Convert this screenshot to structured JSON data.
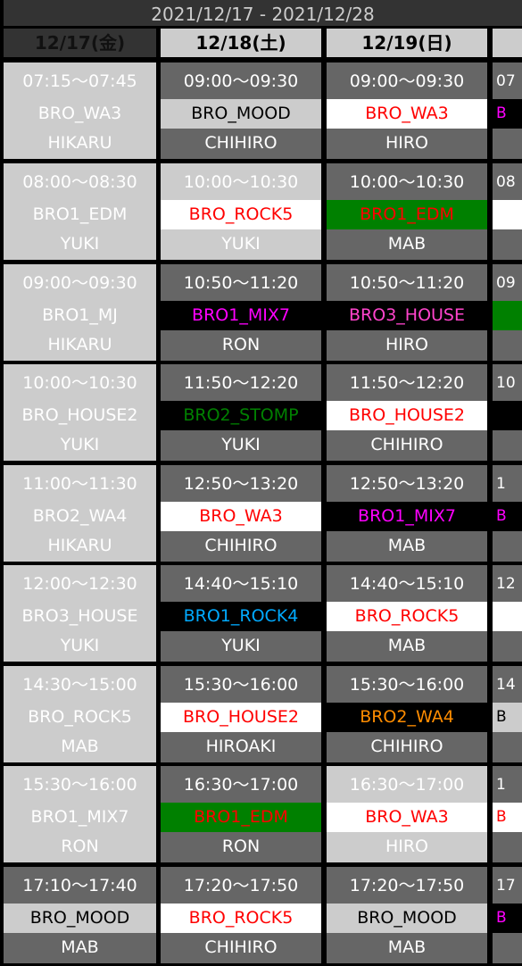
{
  "title": "2021/12/17 - 2021/12/28",
  "columns": [
    {
      "date": "12/17(金)",
      "selected": true,
      "cells": [
        {
          "time": "07:15〜07:45",
          "name": "BRO_WA3",
          "person": "HIKARU",
          "style": "all-light"
        },
        {
          "time": "08:00〜08:30",
          "name": "BRO1_EDM",
          "person": "YUKI",
          "style": "all-light"
        },
        {
          "time": "09:00〜09:30",
          "name": "BRO1_MJ",
          "person": "HIKARU",
          "style": "all-light"
        },
        {
          "time": "10:00〜10:30",
          "name": "BRO_HOUSE2",
          "person": "YUKI",
          "style": "all-light"
        },
        {
          "time": "11:00〜11:30",
          "name": "BRO2_WA4",
          "person": "HIKARU",
          "style": "all-light"
        },
        {
          "time": "12:00〜12:30",
          "name": "BRO3_HOUSE",
          "person": "YUKI",
          "style": "all-light"
        },
        {
          "time": "14:30〜15:00",
          "name": "BRO_ROCK5",
          "person": "MAB",
          "style": "all-light"
        },
        {
          "time": "15:30〜16:00",
          "name": "BRO1_MIX7",
          "person": "RON",
          "style": "all-light"
        },
        {
          "time": "17:10〜17:40",
          "name": "BRO_MOOD",
          "person": "MAB",
          "style": "dark",
          "name_color": "#000000",
          "name_bg": "#cccccc"
        }
      ]
    },
    {
      "date": "12/18(土)",
      "selected": false,
      "cells": [
        {
          "time": "09:00〜09:30",
          "name": "BRO_MOOD",
          "person": "CHIHIRO",
          "style": "dark",
          "name_color": "#000000",
          "name_bg": "#cccccc"
        },
        {
          "time": "10:00〜10:30",
          "name": "BRO_ROCK5",
          "person": "YUKI",
          "style": "light",
          "name_color": "#ff0000",
          "name_bg": "#ffffff"
        },
        {
          "time": "10:50〜11:20",
          "name": "BRO1_MIX7",
          "person": "RON",
          "style": "dark",
          "name_color": "#ff00ff",
          "name_bg": "#000000"
        },
        {
          "time": "11:50〜12:20",
          "name": "BRO2_STOMP",
          "person": "YUKI",
          "style": "dark",
          "name_color": "#008000",
          "name_bg": "#000000"
        },
        {
          "time": "12:50〜13:20",
          "name": "BRO_WA3",
          "person": "CHIHIRO",
          "style": "dark",
          "name_color": "#ff0000",
          "name_bg": "#ffffff"
        },
        {
          "time": "14:40〜15:10",
          "name": "BRO1_ROCK4",
          "person": "YUKI",
          "style": "dark",
          "name_color": "#00aaff",
          "name_bg": "#000000"
        },
        {
          "time": "15:30〜16:00",
          "name": "BRO_HOUSE2",
          "person": "HIROAKI",
          "style": "dark",
          "name_color": "#ff0000",
          "name_bg": "#ffffff"
        },
        {
          "time": "16:30〜17:00",
          "name": "BRO1_EDM",
          "person": "RON",
          "style": "dark",
          "name_color": "#ff0000",
          "name_bg": "#008000"
        },
        {
          "time": "17:20〜17:50",
          "name": "BRO_ROCK5",
          "person": "CHIHIRO",
          "style": "dark",
          "name_color": "#ff0000",
          "name_bg": "#ffffff"
        }
      ]
    },
    {
      "date": "12/19(日)",
      "selected": false,
      "cells": [
        {
          "time": "09:00〜09:30",
          "name": "BRO_WA3",
          "person": "HIRO",
          "style": "dark",
          "name_color": "#ff0000",
          "name_bg": "#ffffff"
        },
        {
          "time": "10:00〜10:30",
          "name": "BRO1_EDM",
          "person": "MAB",
          "style": "dark",
          "name_color": "#ff0000",
          "name_bg": "#008000"
        },
        {
          "time": "10:50〜11:20",
          "name": "BRO3_HOUSE",
          "person": "HIRO",
          "style": "dark",
          "name_color": "#ff44cc",
          "name_bg": "#000000"
        },
        {
          "time": "11:50〜12:20",
          "name": "BRO_HOUSE2",
          "person": "CHIHIRO",
          "style": "dark",
          "name_color": "#ff0000",
          "name_bg": "#ffffff"
        },
        {
          "time": "12:50〜13:20",
          "name": "BRO1_MIX7",
          "person": "MAB",
          "style": "dark",
          "name_color": "#ff00ff",
          "name_bg": "#000000"
        },
        {
          "time": "14:40〜15:10",
          "name": "BRO_ROCK5",
          "person": "MAB",
          "style": "dark",
          "name_color": "#ff0000",
          "name_bg": "#ffffff"
        },
        {
          "time": "15:30〜16:00",
          "name": "BRO2_WA4",
          "person": "CHIHIRO",
          "style": "dark",
          "name_color": "#ff8c00",
          "name_bg": "#000000"
        },
        {
          "time": "16:30〜17:00",
          "name": "BRO_WA3",
          "person": "HIRO",
          "style": "light",
          "name_color": "#ff0000",
          "name_bg": "#ffffff"
        },
        {
          "time": "17:20〜17:50",
          "name": "BRO_MOOD",
          "person": "MAB",
          "style": "dark",
          "name_color": "#000000",
          "name_bg": "#cccccc"
        }
      ]
    },
    {
      "date": "",
      "selected": false,
      "cells": [
        {
          "time": "07",
          "name": "B",
          "person": "",
          "style": "dark",
          "name_color": "#ff00ff",
          "name_bg": "#000000"
        },
        {
          "time": "08",
          "name": "",
          "person": "",
          "style": "dark",
          "name_color": "#ff0000",
          "name_bg": "#ffffff"
        },
        {
          "time": "09",
          "name": "",
          "person": "",
          "style": "dark",
          "name_color": "#ff0000",
          "name_bg": "#008000"
        },
        {
          "time": "10",
          "name": "",
          "person": "",
          "style": "dark",
          "name_color": "#ffffff",
          "name_bg": "#000000"
        },
        {
          "time": "1",
          "name": "B",
          "person": "",
          "style": "dark",
          "name_color": "#ff00ff",
          "name_bg": "#000000"
        },
        {
          "time": "12",
          "name": "",
          "person": "",
          "style": "dark",
          "name_color": "#ff0000",
          "name_bg": "#ffffff"
        },
        {
          "time": "14",
          "name": "B",
          "person": "",
          "style": "dark",
          "name_color": "#000000",
          "name_bg": "#cccccc"
        },
        {
          "time": "1",
          "name": "B",
          "person": "",
          "style": "dark",
          "name_color": "#ff0000",
          "name_bg": "#ffffff"
        },
        {
          "time": "17",
          "name": "B",
          "person": "",
          "style": "dark",
          "name_color": "#ff00ff",
          "name_bg": "#000000"
        }
      ]
    }
  ]
}
